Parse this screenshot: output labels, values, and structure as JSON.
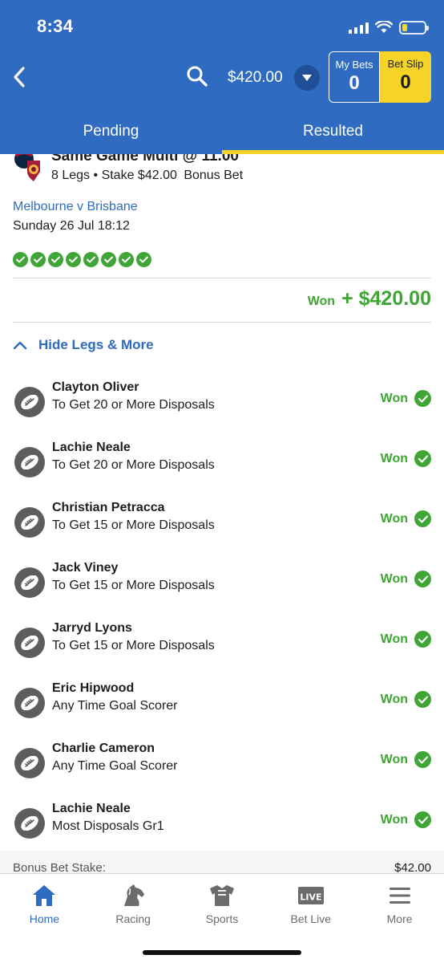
{
  "status_bar": {
    "time": "8:34"
  },
  "header": {
    "balance": "$420.00",
    "my_bets": {
      "label": "My Bets",
      "count": "0"
    },
    "bet_slip": {
      "label": "Bet Slip",
      "count": "0"
    }
  },
  "tabs": [
    {
      "label": "Pending",
      "active": false
    },
    {
      "label": "Resulted",
      "active": true
    }
  ],
  "bet": {
    "title": "Same Game Multi @ 11.00",
    "legs_count": "8 Legs",
    "separator": "•",
    "stake": "Stake $42.00",
    "bonus": "Bonus Bet",
    "match": "Melbourne v Brisbane",
    "date": "Sunday 26 Jul 18:12",
    "result_label": "Won",
    "result_amount": "+ $420.00",
    "toggle_label": "Hide Legs & More"
  },
  "legs": [
    {
      "name": "Clayton Oliver",
      "desc": "To Get 20 or More Disposals",
      "status": "Won"
    },
    {
      "name": "Lachie Neale",
      "desc": "To Get 20 or More Disposals",
      "status": "Won"
    },
    {
      "name": "Christian Petracca",
      "desc": "To Get 15 or More Disposals",
      "status": "Won"
    },
    {
      "name": "Jack Viney",
      "desc": "To Get 15 or More Disposals",
      "status": "Won"
    },
    {
      "name": "Jarryd Lyons",
      "desc": "To Get 15 or More Disposals",
      "status": "Won"
    },
    {
      "name": "Eric Hipwood",
      "desc": "Any Time Goal Scorer",
      "status": "Won"
    },
    {
      "name": "Charlie Cameron",
      "desc": "Any Time Goal Scorer",
      "status": "Won"
    },
    {
      "name": "Lachie Neale",
      "desc": "Most Disposals Gr1",
      "status": "Won"
    }
  ],
  "bonus_stake": {
    "label": "Bonus Bet Stake:",
    "value": "$42.00"
  },
  "bottom_nav": [
    {
      "label": "Home",
      "icon": "home-icon",
      "active": true
    },
    {
      "label": "Racing",
      "icon": "horse-icon",
      "active": false
    },
    {
      "label": "Sports",
      "icon": "jersey-icon",
      "active": false
    },
    {
      "label": "Bet Live",
      "icon": "live-icon",
      "active": false
    },
    {
      "label": "More",
      "icon": "menu-icon",
      "active": false
    }
  ],
  "colors": {
    "brand_blue": "#2f6bc0",
    "accent_yellow": "#f5d328",
    "won_green": "#3fa535"
  }
}
